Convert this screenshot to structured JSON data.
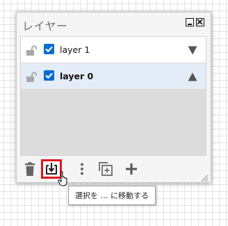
{
  "panel": {
    "title": "レイヤー"
  },
  "layers": [
    {
      "name": "layer 1",
      "checked": true,
      "arrow": "down-triangle-icon",
      "selected": false
    },
    {
      "name": "layer 0",
      "checked": true,
      "arrow": "up-triangle-icon",
      "selected": true
    }
  ],
  "toolbar": {
    "icons": [
      "trash-icon",
      "move-to-layer-icon",
      "more-vertical-icon",
      "duplicate-icon",
      "add-icon"
    ],
    "highlight_color": "#e3151a"
  },
  "tooltip": {
    "text": "選択を … に移動する"
  },
  "colors": {
    "selected_row": "#e4ecf7",
    "checkbox": "#0b6ccf"
  }
}
